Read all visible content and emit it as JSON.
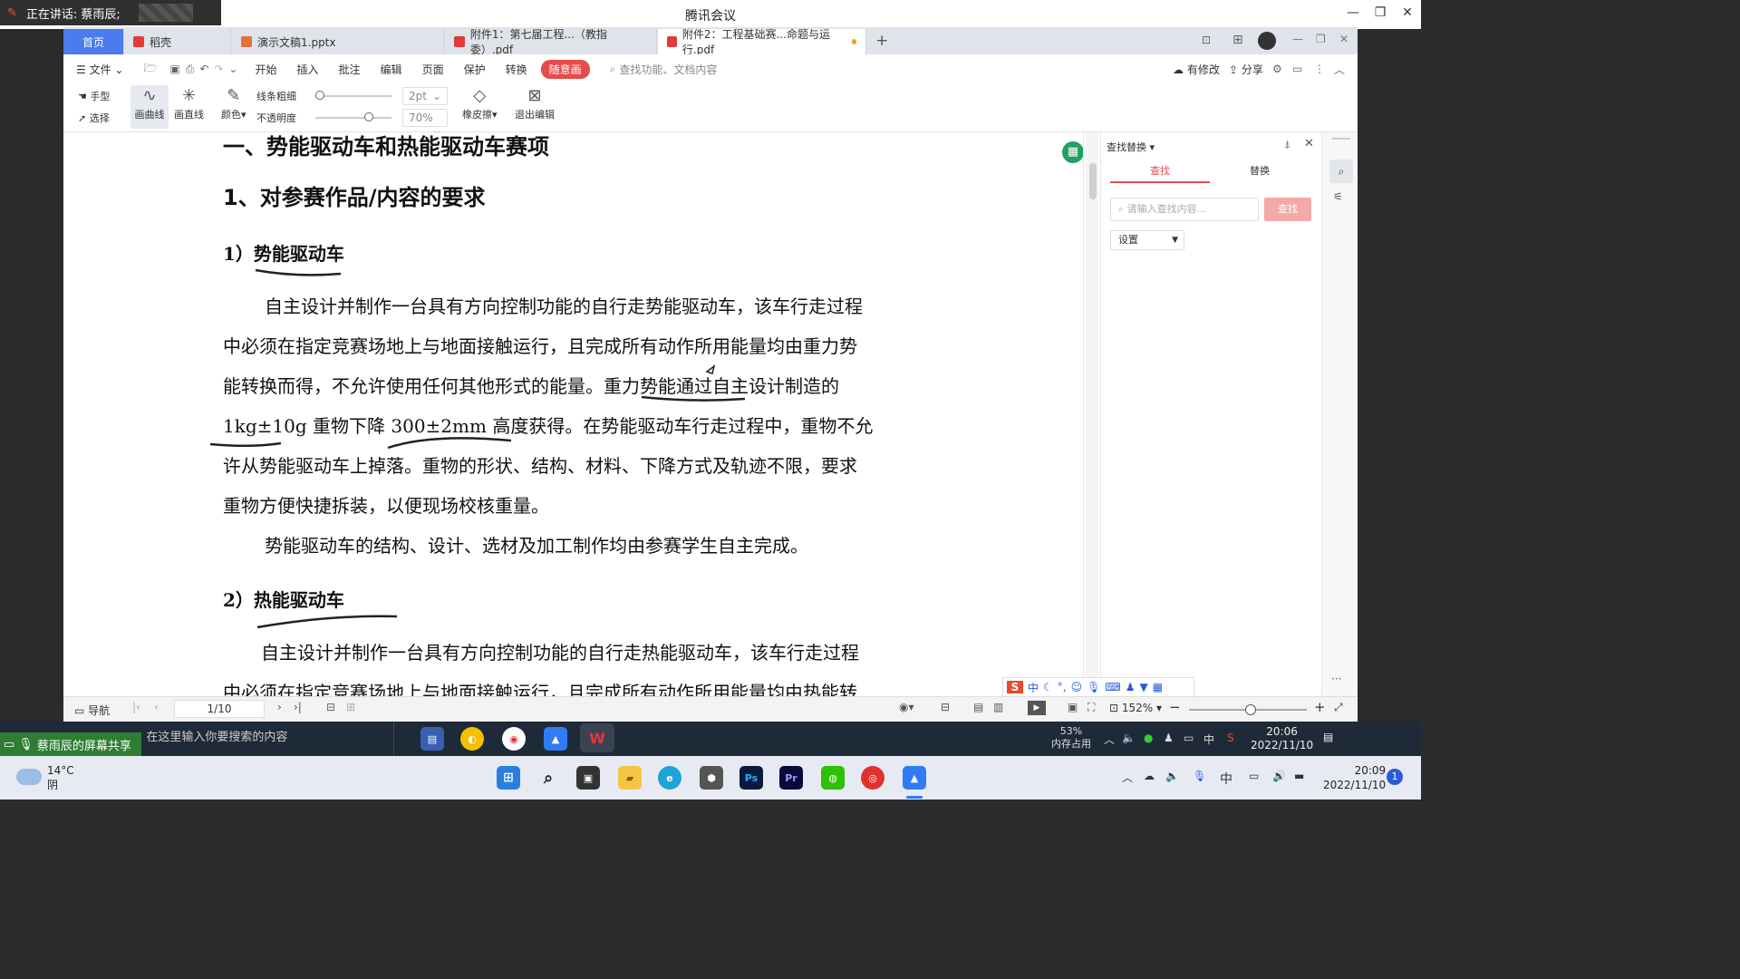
{
  "meeting": {
    "speaker_label": "正在讲话: 蔡雨辰;",
    "title": "腾讯会议"
  },
  "tabs": [
    {
      "label": "首页"
    },
    {
      "label": "稻壳"
    },
    {
      "label": "演示文稿1.pptx"
    },
    {
      "label": "附件1：第七届工程...（教指委）.pdf"
    },
    {
      "label": "附件2：工程基础赛...命题与运行.pdf"
    }
  ],
  "menu": {
    "file": "文件",
    "items": [
      "开始",
      "插入",
      "批注",
      "编辑",
      "页面",
      "保护",
      "转换"
    ],
    "special": "随意画",
    "search_placeholder": "查找功能、文档内容",
    "has_changes": "有修改",
    "share": "分享"
  },
  "toolbar": {
    "hand": "手型",
    "select": "选择",
    "curve": "画曲线",
    "line": "画直线",
    "color": "颜色",
    "line_width_label": "线条粗细",
    "opacity_label": "不透明度",
    "line_width_value": "2pt",
    "opacity_value": "70%",
    "opacity_level": 0.7,
    "eraser": "橡皮擦",
    "exit": "退出编辑"
  },
  "document": {
    "section_title": "一、势能驱动车和热能驱动车赛项",
    "subsection_title": "1、对参赛作品/内容的要求",
    "item1_title": "1）势能驱动车",
    "item1_lines": [
      "自主设计并制作一台具有方向控制功能的自行走势能驱动车，该车行走过程",
      "中必须在指定竞赛场地上与地面接触运行，且完成所有动作所用能量均由重力势",
      "能转换而得，不允许使用任何其他形式的能量。重力势能通过自主设计制造的",
      "1kg±10g 重物下降 300±2mm 高度获得。在势能驱动车行走过程中，重物不允",
      "许从势能驱动车上掉落。重物的形状、结构、材料、下降方式及轨迹不限，要求",
      "重物方便快捷拆装，以便现场校核重量。"
    ],
    "item1_para2": "势能驱动车的结构、设计、选材及加工制作均由参赛学生自主完成。",
    "item2_title": "2）热能驱动车",
    "item2_lines": [
      "自主设计并制作一台具有方向控制功能的自行走热能驱动车，该车行走过程",
      "中必须在指定竞赛场地上与地面接触运行，且完成所有动作所用能量均由热能转"
    ]
  },
  "find_panel": {
    "title": "查找替换",
    "tab_find": "查找",
    "tab_replace": "替换",
    "input_placeholder": "请输入查找内容...",
    "find_button": "查找",
    "settings": "设置"
  },
  "statusbar": {
    "nav": "导航",
    "page": "1/10",
    "zoom": "152%"
  },
  "remote_taskbar": {
    "share_label": "蔡雨辰的屏幕共享",
    "search_placeholder": "在这里输入你要搜索的内容",
    "memory_percent": "53%",
    "memory_label": "内存占用",
    "ime": "中",
    "time": "20:06",
    "date": "2022/11/10"
  },
  "local_taskbar": {
    "temp": "14°C",
    "weather": "阴",
    "ime": "中",
    "time": "20:09",
    "date": "2022/11/10",
    "notif_count": "1"
  },
  "colors": {
    "accent_blue": "#4a7cf0",
    "accent_red": "#e84a4a",
    "share_green": "#2e7d32"
  }
}
